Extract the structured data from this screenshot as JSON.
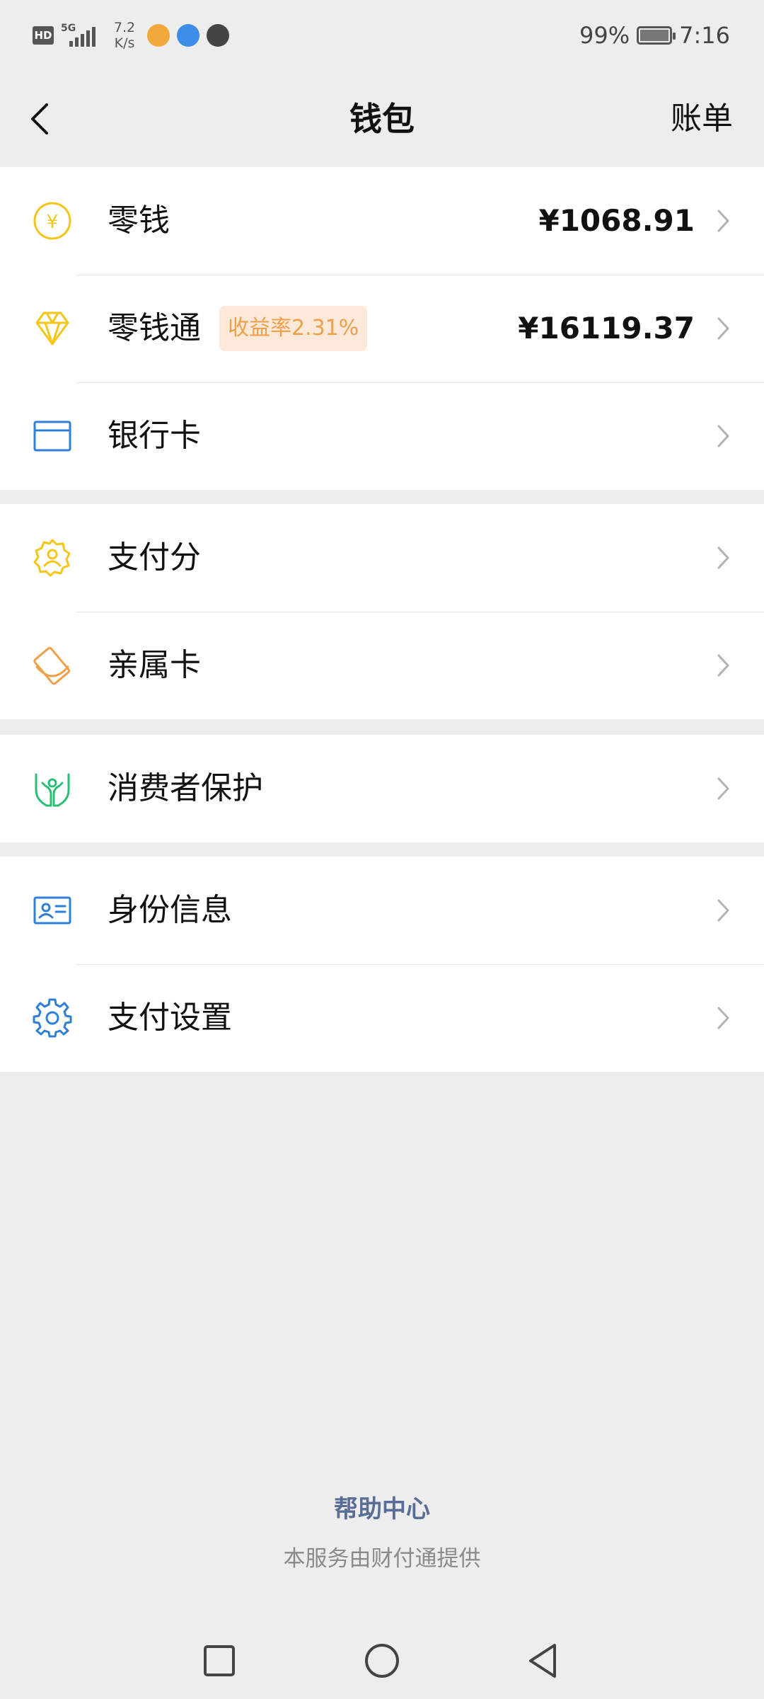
{
  "status_bar": {
    "hd": "HD",
    "network": "5G",
    "speed_value": "7.2",
    "speed_unit": "K/s",
    "battery_percent": "99%",
    "battery_level": 0.99,
    "time": "7:16"
  },
  "nav": {
    "title": "钱包",
    "right_action": "账单"
  },
  "groups": [
    {
      "items": [
        {
          "label": "零钱",
          "value": "¥1068.91",
          "icon": "yuan-coin-icon"
        },
        {
          "label": "零钱通",
          "badge": "收益率2.31%",
          "value": "¥16119.37",
          "icon": "diamond-icon"
        },
        {
          "label": "银行卡",
          "icon": "bank-card-icon"
        }
      ]
    },
    {
      "items": [
        {
          "label": "支付分",
          "icon": "credit-score-icon"
        },
        {
          "label": "亲属卡",
          "icon": "family-card-icon"
        }
      ]
    },
    {
      "items": [
        {
          "label": "消费者保护",
          "icon": "protect-hands-icon"
        }
      ]
    },
    {
      "items": [
        {
          "label": "身份信息",
          "icon": "id-card-icon"
        },
        {
          "label": "支付设置",
          "icon": "gear-icon"
        }
      ]
    }
  ],
  "footer": {
    "help": "帮助中心",
    "provider": "本服务由财付通提供"
  },
  "colors": {
    "background": "#ededed",
    "yellow": "#f5c518",
    "blue": "#2f7fd6",
    "orange": "#f0a04b",
    "green": "#2bbf75",
    "help_link": "#5a6d96"
  }
}
